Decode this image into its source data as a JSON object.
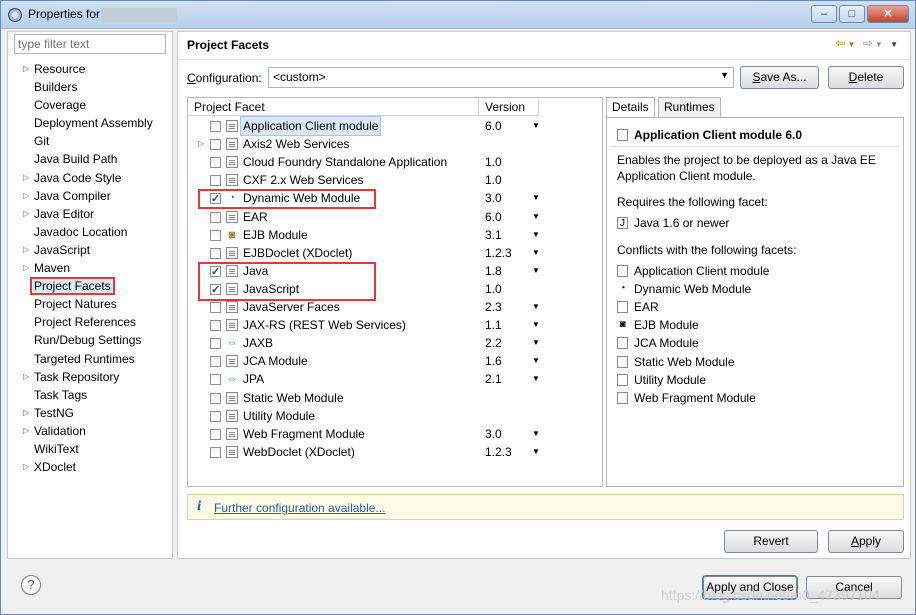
{
  "window": {
    "title": "Properties for"
  },
  "filter": {
    "placeholder": "type filter text"
  },
  "nav": [
    {
      "label": "Resource",
      "expandable": true
    },
    {
      "label": "Builders",
      "expandable": false
    },
    {
      "label": "Coverage",
      "expandable": false
    },
    {
      "label": "Deployment Assembly",
      "expandable": false
    },
    {
      "label": "Git",
      "expandable": false
    },
    {
      "label": "Java Build Path",
      "expandable": false
    },
    {
      "label": "Java Code Style",
      "expandable": true
    },
    {
      "label": "Java Compiler",
      "expandable": true
    },
    {
      "label": "Java Editor",
      "expandable": true
    },
    {
      "label": "Javadoc Location",
      "expandable": false
    },
    {
      "label": "JavaScript",
      "expandable": true
    },
    {
      "label": "Maven",
      "expandable": true
    },
    {
      "label": "Project Facets",
      "expandable": false,
      "selected": true
    },
    {
      "label": "Project Natures",
      "expandable": false
    },
    {
      "label": "Project References",
      "expandable": false
    },
    {
      "label": "Run/Debug Settings",
      "expandable": false
    },
    {
      "label": "Targeted Runtimes",
      "expandable": false
    },
    {
      "label": "Task Repository",
      "expandable": true
    },
    {
      "label": "Task Tags",
      "expandable": false
    },
    {
      "label": "TestNG",
      "expandable": true
    },
    {
      "label": "Validation",
      "expandable": true
    },
    {
      "label": "WikiText",
      "expandable": false
    },
    {
      "label": "XDoclet",
      "expandable": true
    }
  ],
  "page": {
    "title": "Project Facets",
    "configuration_label": "Configuration:",
    "configuration_value": "<custom>",
    "save_as_label": "Save As...",
    "delete_label": "Delete"
  },
  "table": {
    "col_facet": "Project Facet",
    "col_version": "Version",
    "rows": [
      {
        "name": "Application Client module",
        "version": "6.0",
        "checked": false,
        "dropdown": true,
        "icon": "page-icon",
        "selected": true
      },
      {
        "name": "Axis2 Web Services",
        "version": "",
        "checked": false,
        "dropdown": false,
        "icon": "page-icon",
        "expandable": true
      },
      {
        "name": "Cloud Foundry Standalone Application",
        "version": "1.0",
        "checked": false,
        "dropdown": false,
        "icon": "page-icon"
      },
      {
        "name": "CXF 2.x Web Services",
        "version": "1.0",
        "checked": false,
        "dropdown": false,
        "icon": "page-icon"
      },
      {
        "name": "Dynamic Web Module",
        "version": "3.0",
        "checked": true,
        "dropdown": true,
        "icon": "globe-icon"
      },
      {
        "name": "EAR",
        "version": "6.0",
        "checked": false,
        "dropdown": true,
        "icon": "page-icon"
      },
      {
        "name": "EJB Module",
        "version": "3.1",
        "checked": false,
        "dropdown": true,
        "icon": "bean-icon"
      },
      {
        "name": "EJBDoclet (XDoclet)",
        "version": "1.2.3",
        "checked": false,
        "dropdown": true,
        "icon": "page-icon"
      },
      {
        "name": "Java",
        "version": "1.8",
        "checked": true,
        "dropdown": true,
        "icon": "java-icon"
      },
      {
        "name": "JavaScript",
        "version": "1.0",
        "checked": true,
        "dropdown": false,
        "icon": "page-icon"
      },
      {
        "name": "JavaServer Faces",
        "version": "2.3",
        "checked": false,
        "dropdown": true,
        "icon": "page-icon"
      },
      {
        "name": "JAX-RS (REST Web Services)",
        "version": "1.1",
        "checked": false,
        "dropdown": true,
        "icon": "page-icon"
      },
      {
        "name": "JAXB",
        "version": "2.2",
        "checked": false,
        "dropdown": true,
        "icon": "arrows-icon"
      },
      {
        "name": "JCA Module",
        "version": "1.6",
        "checked": false,
        "dropdown": true,
        "icon": "page-icon"
      },
      {
        "name": "JPA",
        "version": "2.1",
        "checked": false,
        "dropdown": true,
        "icon": "arrows-icon"
      },
      {
        "name": "Static Web Module",
        "version": "",
        "checked": false,
        "dropdown": false,
        "icon": "page-icon"
      },
      {
        "name": "Utility Module",
        "version": "",
        "checked": false,
        "dropdown": false,
        "icon": "page-icon"
      },
      {
        "name": "Web Fragment Module",
        "version": "3.0",
        "checked": false,
        "dropdown": true,
        "icon": "page-icon"
      },
      {
        "name": "WebDoclet (XDoclet)",
        "version": "1.2.3",
        "checked": false,
        "dropdown": true,
        "icon": "page-icon"
      }
    ]
  },
  "details": {
    "tab_details": "Details",
    "tab_runtimes": "Runtimes",
    "title": "Application Client module 6.0",
    "desc_line1": "Enables the project to be deployed as a Java EE",
    "desc_line2": "Application Client module.",
    "requires_label": "Requires the following facet:",
    "requires": [
      {
        "label": "Java 1.6 or newer",
        "icon": "java-icon"
      }
    ],
    "conflicts_label": "Conflicts with the following facets:",
    "conflicts": [
      {
        "label": "Application Client module",
        "icon": "page-icon"
      },
      {
        "label": "Dynamic Web Module",
        "icon": "globe-icon"
      },
      {
        "label": "EAR",
        "icon": "page-icon"
      },
      {
        "label": "EJB Module",
        "icon": "bean-icon"
      },
      {
        "label": "JCA Module",
        "icon": "page-icon"
      },
      {
        "label": "Static Web Module",
        "icon": "page-icon"
      },
      {
        "label": "Utility Module",
        "icon": "page-icon"
      },
      {
        "label": "Web Fragment Module",
        "icon": "page-icon"
      }
    ]
  },
  "info": {
    "icon": "i",
    "link": "Further configuration available..."
  },
  "buttons": {
    "revert": "Revert",
    "apply": "Apply",
    "apply_close": "Apply and Close",
    "cancel": "Cancel",
    "help": "?"
  },
  "watermark": "https://blog.csdn.net/m0_47397104",
  "colors": {
    "highlight_red": "#e53935",
    "link_blue": "#1f5fb4",
    "selection": "#dbe8f8"
  }
}
